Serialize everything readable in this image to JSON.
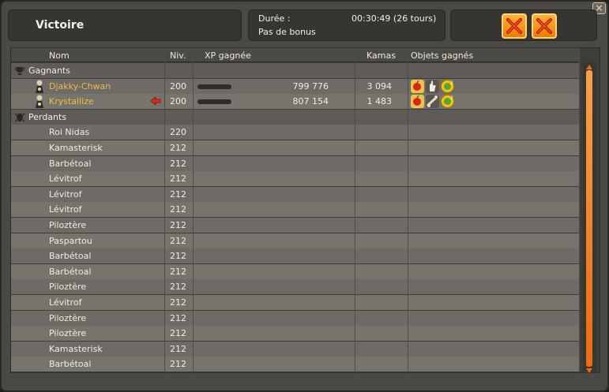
{
  "window": {
    "title": "Victoire",
    "close_icon": "close-icon",
    "duration_label": "Durée :",
    "duration_value": "00:30:49 (26 tours)",
    "bonus_text": "Pas de bonus",
    "buttons": [
      {
        "icon": "cross-icon",
        "accent": "#f07b00"
      },
      {
        "icon": "cross-icon",
        "accent": "#f07b00"
      }
    ]
  },
  "table": {
    "headers": {
      "name": "Nom",
      "level": "Niv.",
      "xp": "XP gagnée",
      "kamas": "Kamas",
      "items": "Objets gagnés"
    },
    "groups": {
      "winners": {
        "label": "Gagnants",
        "icon": "trophy-icon"
      },
      "losers": {
        "label": "Perdants",
        "icon": "skull-icon"
      }
    },
    "winners": [
      {
        "name": "Djakky-Chwan",
        "level": "200",
        "xp": "799 776",
        "kamas": "3 094",
        "items": [
          "apple-icon",
          "hand-icon",
          "gold-badge-icon"
        ],
        "avatar": "avatar-icon"
      },
      {
        "name": "Krystallize",
        "level": "200",
        "xp": "807 154",
        "kamas": "1 483",
        "items": [
          "apple-icon",
          "bone-icon",
          "gold-badge-icon"
        ],
        "avatar": "avatar-icon",
        "marked": true
      }
    ],
    "losers": [
      {
        "name": "Roi Nidas",
        "level": "220"
      },
      {
        "name": "Kamasterisk",
        "level": "212"
      },
      {
        "name": "Barbétoal",
        "level": "212"
      },
      {
        "name": "Lévitrof",
        "level": "212"
      },
      {
        "name": "Lévitrof",
        "level": "212"
      },
      {
        "name": "Lévitrof",
        "level": "212"
      },
      {
        "name": "Piloztère",
        "level": "212"
      },
      {
        "name": "Paspartou",
        "level": "212"
      },
      {
        "name": "Barbétoal",
        "level": "212"
      },
      {
        "name": "Barbétoal",
        "level": "212"
      },
      {
        "name": "Piloztère",
        "level": "212"
      },
      {
        "name": "Lévitrof",
        "level": "212"
      },
      {
        "name": "Piloztère",
        "level": "212"
      },
      {
        "name": "Piloztère",
        "level": "212"
      },
      {
        "name": "Kamasterisk",
        "level": "212"
      },
      {
        "name": "Barbétoal",
        "level": "212"
      }
    ]
  },
  "colors": {
    "winner_name": "#f3b944",
    "scrollbar": "#ea6b13",
    "marker_arrow": "#e02a1a"
  }
}
